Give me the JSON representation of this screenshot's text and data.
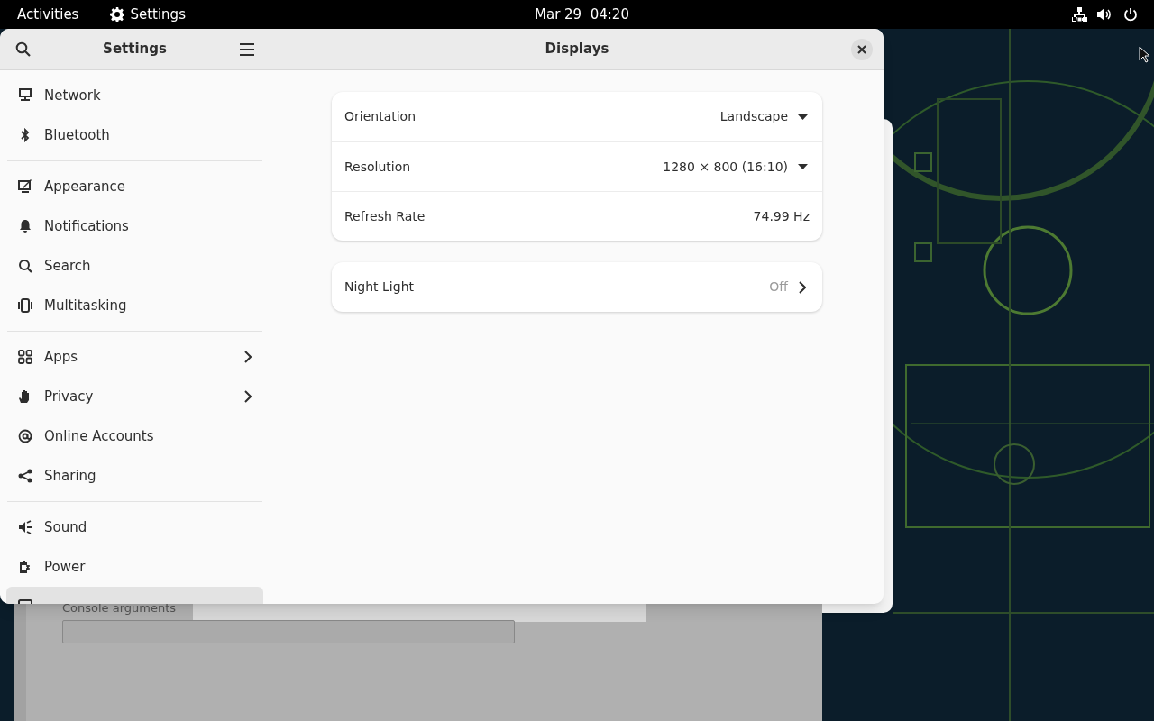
{
  "top_bar": {
    "activities": "Activities",
    "app_name": "Settings",
    "clock": "Mar 29  04:20"
  },
  "settings_window": {
    "sidebar": {
      "title": "Settings",
      "groups": [
        {
          "items": [
            {
              "label": "Network",
              "chevron": false,
              "selected": false
            },
            {
              "label": "Bluetooth",
              "chevron": false,
              "selected": false
            }
          ]
        },
        {
          "items": [
            {
              "label": "Appearance",
              "chevron": false,
              "selected": false
            },
            {
              "label": "Notifications",
              "chevron": false,
              "selected": false
            },
            {
              "label": "Search",
              "chevron": false,
              "selected": false
            },
            {
              "label": "Multitasking",
              "chevron": false,
              "selected": false
            }
          ]
        },
        {
          "items": [
            {
              "label": "Apps",
              "chevron": true,
              "selected": false
            },
            {
              "label": "Privacy",
              "chevron": true,
              "selected": false
            },
            {
              "label": "Online Accounts",
              "chevron": false,
              "selected": false
            },
            {
              "label": "Sharing",
              "chevron": false,
              "selected": false
            }
          ]
        },
        {
          "items": [
            {
              "label": "Sound",
              "chevron": false,
              "selected": false
            },
            {
              "label": "Power",
              "chevron": false,
              "selected": false
            },
            {
              "chevron": false,
              "selected": true
            }
          ]
        }
      ]
    },
    "content": {
      "title": "Displays",
      "groups": [
        {
          "rows": [
            {
              "kind": "dropdown",
              "label": "Orientation",
              "value": "Landscape"
            },
            {
              "kind": "dropdown",
              "label": "Resolution",
              "value": "1280 × 800 (16:10)"
            },
            {
              "kind": "static",
              "label": "Refresh Rate",
              "value": "74.99 Hz"
            }
          ]
        },
        {
          "rows": [
            {
              "kind": "link",
              "label": "Night Light",
              "value": "Off"
            }
          ]
        }
      ]
    }
  },
  "background_window": {
    "field_label": "Console arguments"
  }
}
